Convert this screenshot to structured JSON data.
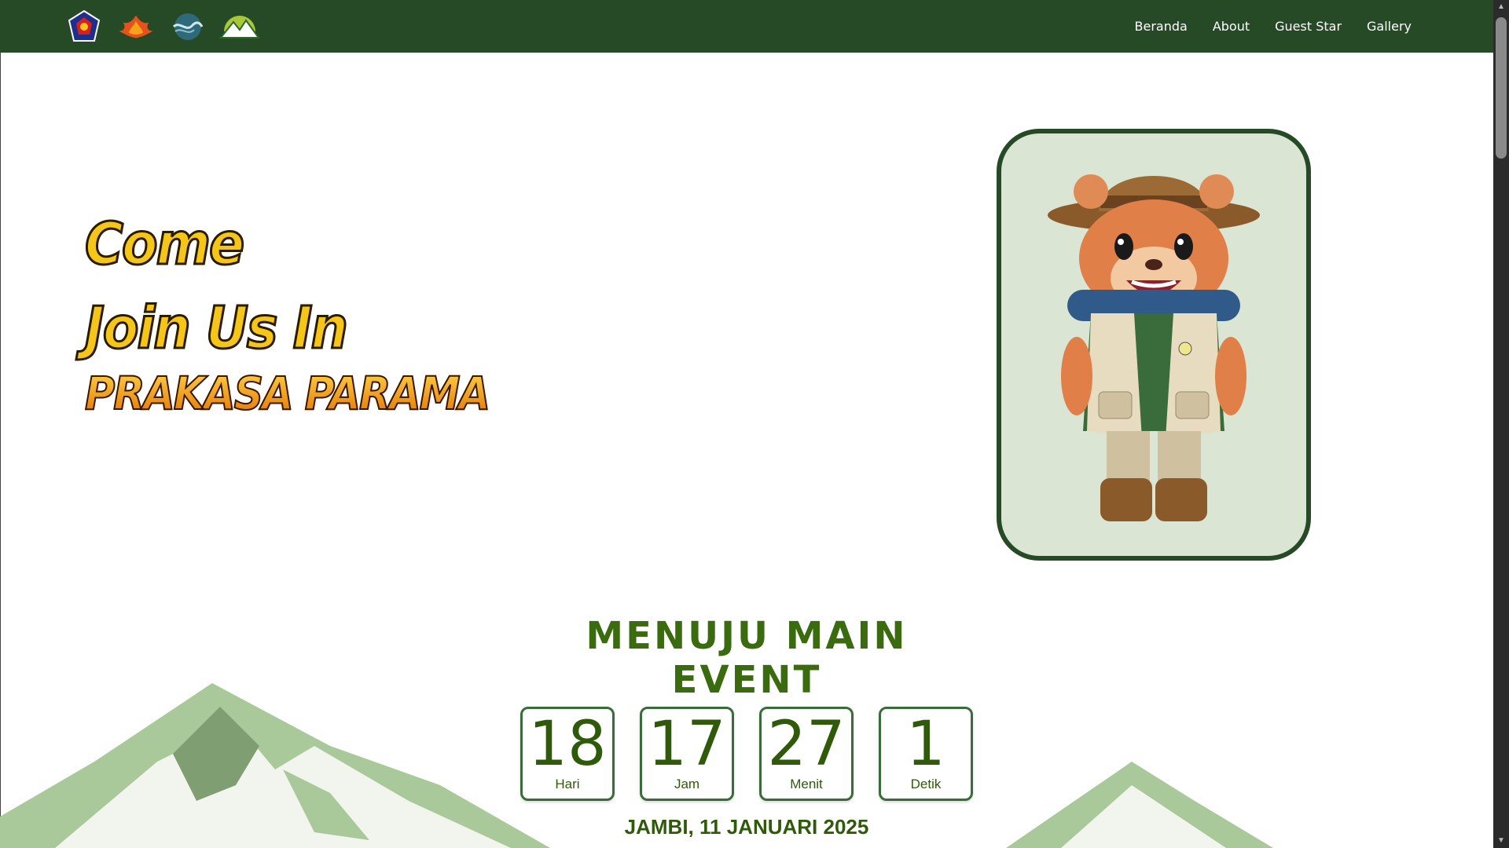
{
  "nav": {
    "logos": [
      "school-crest-logo",
      "flame-emblem-logo",
      "wave-emblem-logo",
      "mountain-sun-logo"
    ],
    "links": [
      "Beranda",
      "About",
      "Guest Star",
      "Gallery"
    ]
  },
  "hero": {
    "line1": "Come",
    "line2": "Join Us In",
    "brand": "PRAKASA PARAMA"
  },
  "mascot": {
    "icon": "bear-scout-mascot"
  },
  "countdown": {
    "title": "MENUJU MAIN EVENT",
    "items": [
      {
        "value": "18",
        "label": "Hari"
      },
      {
        "value": "17",
        "label": "Jam"
      },
      {
        "value": "27",
        "label": "Menit"
      },
      {
        "value": "1",
        "label": "Detik"
      }
    ],
    "date": "JAMBI, 11 JANUARI 2025"
  },
  "colors": {
    "nav_bg": "#264a26",
    "accent_green": "#3a6b0e",
    "hero_yellow": "#f5c518"
  }
}
